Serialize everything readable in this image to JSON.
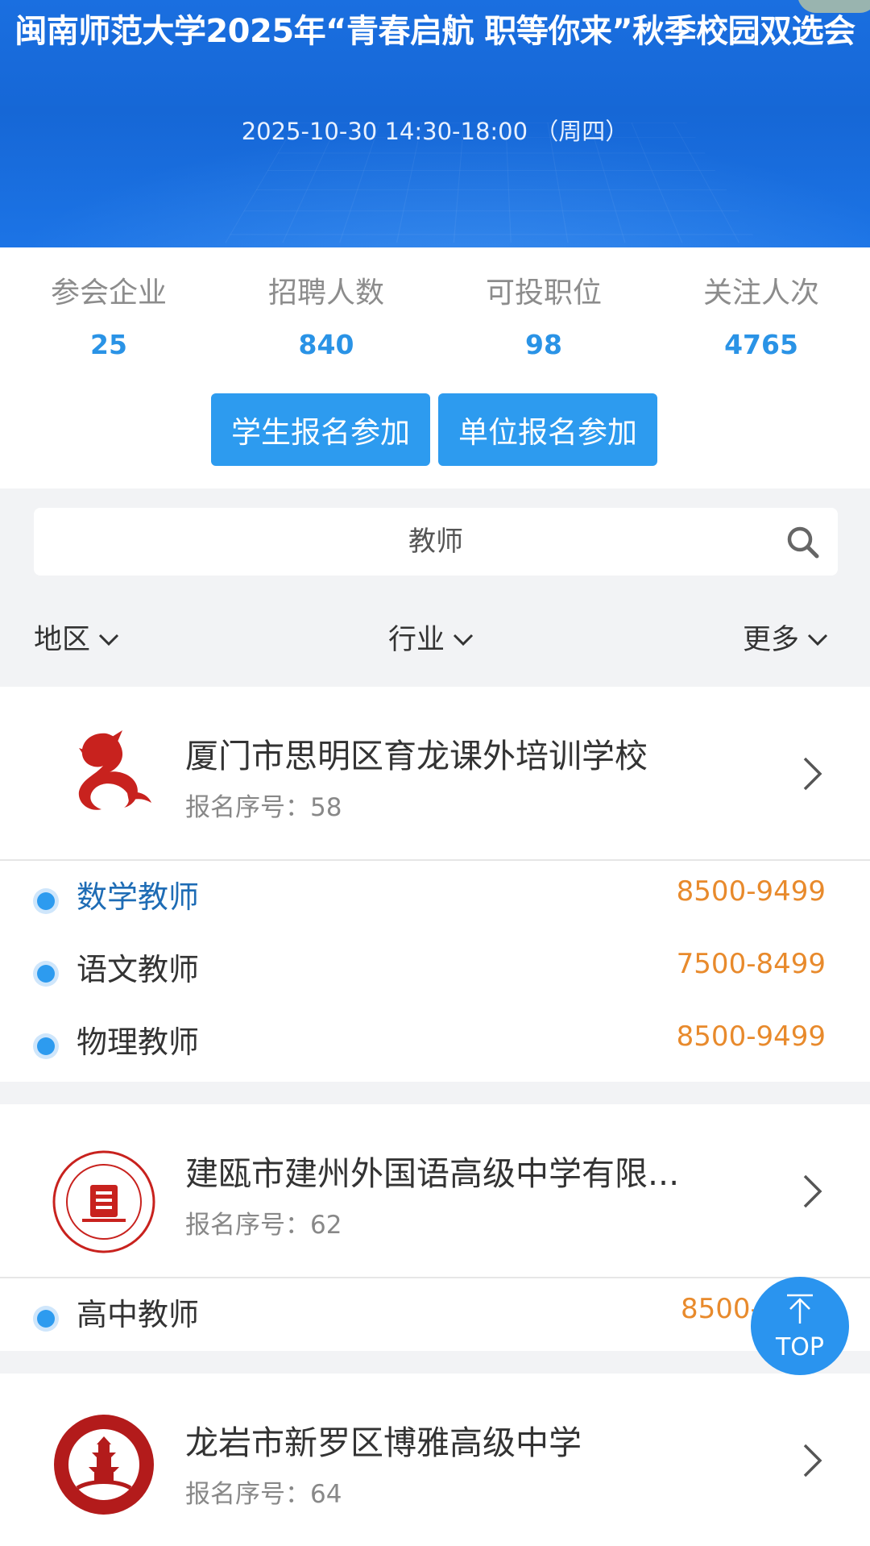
{
  "header": {
    "title": "闽南师范大学2025年“青春启航 职等你来”秋季校园双选会",
    "datetime": "2025-10-30 14:30-18:00 （周四）"
  },
  "stats": [
    {
      "label": "参会企业",
      "value": "25"
    },
    {
      "label": "招聘人数",
      "value": "840"
    },
    {
      "label": "可投职位",
      "value": "98"
    },
    {
      "label": "关注人次",
      "value": "4765"
    }
  ],
  "actions": {
    "student_register": "学生报名参加",
    "company_register": "单位报名参加"
  },
  "search": {
    "value": "教师",
    "icon": "search-icon"
  },
  "filters": {
    "region": "地区",
    "industry": "行业",
    "more": "更多"
  },
  "companies": [
    {
      "name": "厦门市思明区育龙课外培训学校",
      "reg_label": "报名序号：",
      "reg_no": "58",
      "jobs": [
        {
          "title": "数学教师",
          "salary": "8500-9499"
        },
        {
          "title": "语文教师",
          "salary": "7500-8499"
        },
        {
          "title": "物理教师",
          "salary": "8500-9499"
        }
      ]
    },
    {
      "name": "建瓯市建州外国语高级中学有限...",
      "reg_label": "报名序号：",
      "reg_no": "62",
      "jobs": [
        {
          "title": "高中教师",
          "salary": "8500-"
        }
      ]
    },
    {
      "name": "龙岩市新罗区博雅高级中学",
      "reg_label": "报名序号：",
      "reg_no": "64",
      "jobs": []
    }
  ],
  "top_button": "TOP",
  "colors": {
    "accent": "#2d9bef",
    "salary": "#e88a2c",
    "header": "#1a6fe0"
  }
}
